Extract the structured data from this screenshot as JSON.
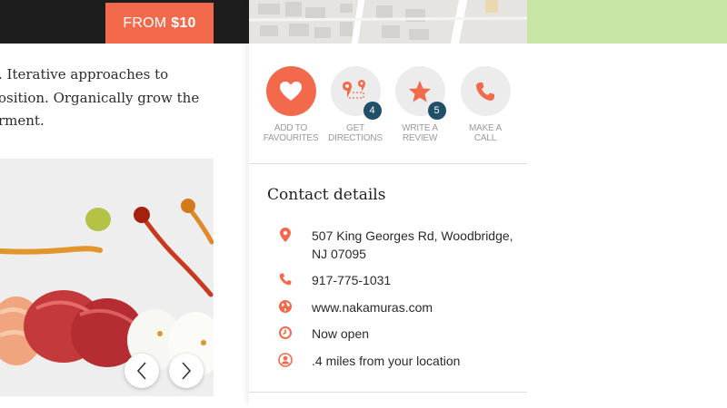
{
  "header": {
    "price_prefix": "FROM",
    "price_value": "$10"
  },
  "description": {
    "lines": [
      ". Iterative approaches to",
      "osition. Organically grow the",
      "rment."
    ]
  },
  "actions": [
    {
      "label_line1": "ADD TO",
      "label_line2": "FAVOURITES",
      "icon": "heart-icon",
      "badge": ""
    },
    {
      "label_line1": "GET",
      "label_line2": "DIRECTIONS",
      "icon": "map-route-icon",
      "badge": "4"
    },
    {
      "label_line1": "WRITE A",
      "label_line2": "REVIEW",
      "icon": "star-icon",
      "badge": "5"
    },
    {
      "label_line1": "MAKE A",
      "label_line2": "CALL",
      "icon": "phone-icon",
      "badge": ""
    }
  ],
  "contact": {
    "title": "Contact details",
    "address": "507 King Georges Rd, Woodbridge, NJ 07095",
    "phone": "917-775-1031",
    "website": "www.nakamuras.com",
    "hours": "Now open",
    "distance": ".4 miles from your location"
  },
  "colors": {
    "accent": "#f26a4b",
    "badge": "#1f4f69",
    "topbar": "#1d1d1d",
    "icon_circle": "#ececec",
    "park_green": "#c8e6a5"
  }
}
